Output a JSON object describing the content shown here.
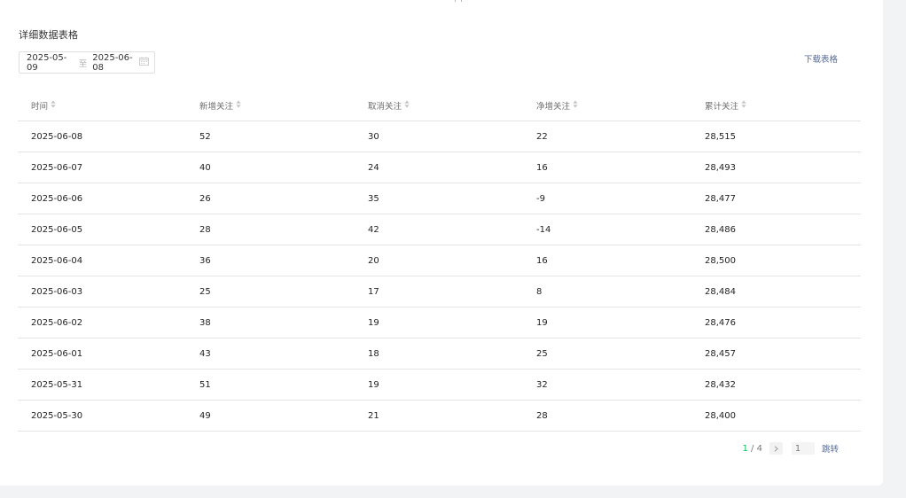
{
  "section_title": "详细数据表格",
  "date_range": {
    "start": "2025-05-09",
    "separator": "至",
    "end": "2025-06-08"
  },
  "download_label": "下载表格",
  "columns": [
    "时间",
    "新增关注",
    "取消关注",
    "净增关注",
    "累计关注"
  ],
  "rows": [
    [
      "2025-06-08",
      "52",
      "30",
      "22",
      "28,515"
    ],
    [
      "2025-06-07",
      "40",
      "24",
      "16",
      "28,493"
    ],
    [
      "2025-06-06",
      "26",
      "35",
      "-9",
      "28,477"
    ],
    [
      "2025-06-05",
      "28",
      "42",
      "-14",
      "28,486"
    ],
    [
      "2025-06-04",
      "36",
      "20",
      "16",
      "28,500"
    ],
    [
      "2025-06-03",
      "25",
      "17",
      "8",
      "28,484"
    ],
    [
      "2025-06-02",
      "38",
      "19",
      "19",
      "28,476"
    ],
    [
      "2025-06-01",
      "43",
      "18",
      "25",
      "28,457"
    ],
    [
      "2025-05-31",
      "51",
      "19",
      "32",
      "28,432"
    ],
    [
      "2025-05-30",
      "49",
      "21",
      "28",
      "28,400"
    ]
  ],
  "pagination": {
    "current": "1",
    "separator": " / ",
    "total": "4",
    "input_placeholder": "1",
    "jump_label": "跳转"
  },
  "icons": {
    "calendar": "calendar-icon",
    "sort": "sort-icon",
    "next": "chevron-right-icon"
  },
  "colors": {
    "accent_green": "#07c160",
    "link_blue": "#576b95"
  }
}
